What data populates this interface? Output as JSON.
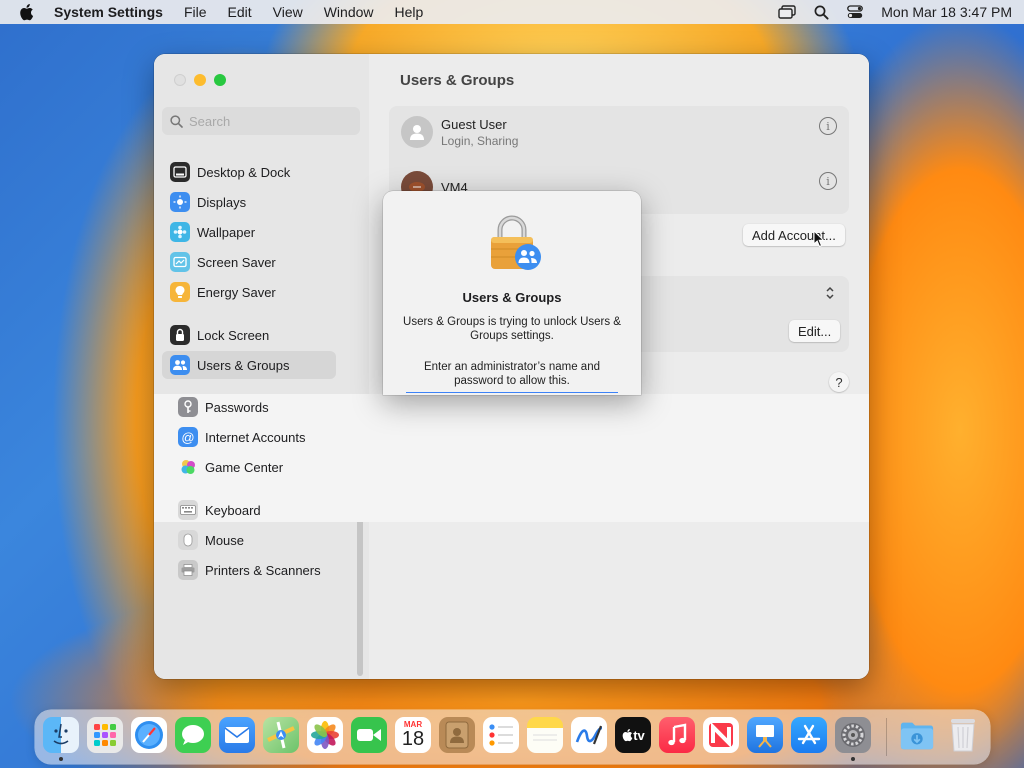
{
  "menubar": {
    "app_name": "System Settings",
    "items": [
      "File",
      "Edit",
      "View",
      "Window",
      "Help"
    ],
    "clock": "Mon Mar 18  3:47 PM"
  },
  "sidebar": {
    "search_placeholder": "Search",
    "items": [
      {
        "label": "Desktop & Dock",
        "icon": "desktop-dock-icon",
        "color": "#2b2b2b"
      },
      {
        "label": "Displays",
        "icon": "displays-icon",
        "color": "#3d8ef0"
      },
      {
        "label": "Wallpaper",
        "icon": "wallpaper-icon",
        "color": "#3fb6e6"
      },
      {
        "label": "Screen Saver",
        "icon": "screen-saver-icon",
        "color": "#62c3e8"
      },
      {
        "label": "Energy Saver",
        "icon": "energy-saver-icon",
        "color": "#f6b53a"
      },
      {
        "label": "Lock Screen",
        "icon": "lock-screen-icon",
        "color": "#2b2b2b"
      },
      {
        "label": "Users & Groups",
        "icon": "users-groups-icon",
        "color": "#3d8ef0"
      },
      {
        "label": "Passwords",
        "icon": "passwords-icon",
        "color": "#8e8e93"
      },
      {
        "label": "Internet Accounts",
        "icon": "internet-accounts-icon",
        "color": "#3d8ef0"
      },
      {
        "label": "Game Center",
        "icon": "game-center-icon",
        "color": "#e04bb0"
      },
      {
        "label": "Keyboard",
        "icon": "keyboard-icon",
        "color": "#b0b0b0"
      },
      {
        "label": "Mouse",
        "icon": "mouse-icon",
        "color": "#b0b0b0"
      },
      {
        "label": "Printers & Scanners",
        "icon": "printers-scanners-icon",
        "color": "#9a9a9a"
      }
    ]
  },
  "main": {
    "title": "Users & Groups",
    "users": [
      {
        "name": "Guest User",
        "subtitle": "Login, Sharing"
      },
      {
        "name": "VM4",
        "subtitle": ""
      }
    ],
    "add_account_label": "Add Account...",
    "edit_label": "Edit...",
    "help_label": "?"
  },
  "dialog": {
    "title": "Users & Groups",
    "message": "Users & Groups is trying to unlock Users & Groups settings.",
    "prompt": "Enter an administrator’s name and password to allow this."
  },
  "dock": {
    "calendar_month": "MAR",
    "calendar_day": "18",
    "tv_label": "tv",
    "apps": [
      {
        "name": "finder-icon",
        "color": "#3ba0f5"
      },
      {
        "name": "launchpad-icon",
        "color": "#e8e8e8"
      },
      {
        "name": "safari-icon",
        "color": "#2f8ff0"
      },
      {
        "name": "messages-icon",
        "color": "#3ecf52"
      },
      {
        "name": "mail-icon",
        "color": "#3a8ef5"
      },
      {
        "name": "maps-icon",
        "color": "#66c36a"
      },
      {
        "name": "photos-icon",
        "color": "#ffffff"
      },
      {
        "name": "facetime-icon",
        "color": "#37c44d"
      },
      {
        "name": "calendar-icon",
        "color": "#ffffff"
      },
      {
        "name": "contacts-icon",
        "color": "#b98a57"
      },
      {
        "name": "reminders-icon",
        "color": "#ffffff"
      },
      {
        "name": "notes-icon",
        "color": "#ffd84a"
      },
      {
        "name": "freeform-icon",
        "color": "#ffffff"
      },
      {
        "name": "tv-icon",
        "color": "#111111"
      },
      {
        "name": "music-icon",
        "color": "#fb3b52"
      },
      {
        "name": "news-icon",
        "color": "#ffffff"
      },
      {
        "name": "keynote-icon",
        "color": "#2f8ff0"
      },
      {
        "name": "app-store-icon",
        "color": "#2b8cf2"
      },
      {
        "name": "system-settings-icon",
        "color": "#8e8e93"
      },
      {
        "name": "downloads-folder-icon",
        "color": "#5fb4ee"
      },
      {
        "name": "trash-icon",
        "color": "#e8e8ea"
      }
    ]
  }
}
